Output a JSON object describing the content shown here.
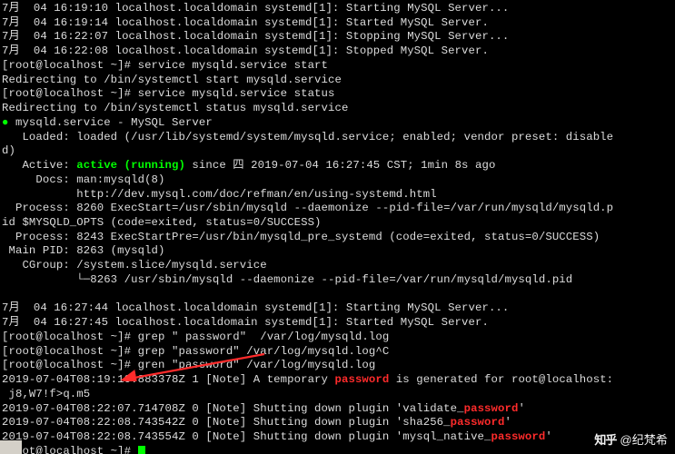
{
  "lines": [
    {
      "segments": [
        {
          "c": "",
          "t": "7月  04 16:19:10 localhost.localdomain systemd[1]: Starting MySQL Server..."
        }
      ]
    },
    {
      "segments": [
        {
          "c": "",
          "t": "7月  04 16:19:14 localhost.localdomain systemd[1]: Started MySQL Server."
        }
      ]
    },
    {
      "segments": [
        {
          "c": "",
          "t": "7月  04 16:22:07 localhost.localdomain systemd[1]: Stopping MySQL Server..."
        }
      ]
    },
    {
      "segments": [
        {
          "c": "",
          "t": "7月  04 16:22:08 localhost.localdomain systemd[1]: Stopped MySQL Server."
        }
      ]
    },
    {
      "segments": [
        {
          "c": "",
          "t": "[root@localhost ~]# service mysqld.service start"
        }
      ]
    },
    {
      "segments": [
        {
          "c": "",
          "t": "Redirecting to /bin/systemctl start mysqld.service"
        }
      ]
    },
    {
      "segments": [
        {
          "c": "",
          "t": "[root@localhost ~]# service mysqld.service status"
        }
      ]
    },
    {
      "segments": [
        {
          "c": "",
          "t": "Redirecting to /bin/systemctl status mysqld.service"
        }
      ]
    },
    {
      "segments": [
        {
          "c": "green",
          "t": "●"
        },
        {
          "c": "",
          "t": " mysqld.service - MySQL Server"
        }
      ]
    },
    {
      "segments": [
        {
          "c": "",
          "t": "   Loaded: loaded (/usr/lib/systemd/system/mysqld.service; enabled; vendor preset: disable"
        }
      ]
    },
    {
      "segments": [
        {
          "c": "",
          "t": "d)"
        }
      ]
    },
    {
      "segments": [
        {
          "c": "",
          "t": "   Active: "
        },
        {
          "c": "green bold",
          "t": "active (running)"
        },
        {
          "c": "",
          "t": " since 四 2019-07-04 16:27:45 CST; 1min 8s ago"
        }
      ]
    },
    {
      "segments": [
        {
          "c": "",
          "t": "     Docs: man:mysqld(8)"
        }
      ]
    },
    {
      "segments": [
        {
          "c": "",
          "t": "           http://dev.mysql.com/doc/refman/en/using-systemd.html"
        }
      ]
    },
    {
      "segments": [
        {
          "c": "",
          "t": "  Process: 8260 ExecStart=/usr/sbin/mysqld --daemonize --pid-file=/var/run/mysqld/mysqld.p"
        }
      ]
    },
    {
      "segments": [
        {
          "c": "",
          "t": "id $MYSQLD_OPTS (code=exited, status=0/SUCCESS)"
        }
      ]
    },
    {
      "segments": [
        {
          "c": "",
          "t": "  Process: 8243 ExecStartPre=/usr/bin/mysqld_pre_systemd (code=exited, status=0/SUCCESS)"
        }
      ]
    },
    {
      "segments": [
        {
          "c": "",
          "t": " Main PID: 8263 (mysqld)"
        }
      ]
    },
    {
      "segments": [
        {
          "c": "",
          "t": "   CGroup: /system.slice/mysqld.service"
        }
      ]
    },
    {
      "segments": [
        {
          "c": "",
          "t": "           └─8263 /usr/sbin/mysqld --daemonize --pid-file=/var/run/mysqld/mysqld.pid"
        }
      ]
    },
    {
      "segments": [
        {
          "c": "",
          "t": " "
        }
      ]
    },
    {
      "segments": [
        {
          "c": "",
          "t": "7月  04 16:27:44 localhost.localdomain systemd[1]: Starting MySQL Server..."
        }
      ]
    },
    {
      "segments": [
        {
          "c": "",
          "t": "7月  04 16:27:45 localhost.localdomain systemd[1]: Started MySQL Server."
        }
      ]
    },
    {
      "segments": [
        {
          "c": "",
          "t": "[root@localhost ~]# grep \" password\"  /var/log/mysqld.log"
        }
      ]
    },
    {
      "segments": [
        {
          "c": "",
          "t": "[root@localhost ~]# grep \"password\" /var/log/mysqld.log^C"
        }
      ]
    },
    {
      "segments": [
        {
          "c": "",
          "t": "[root@localhost ~]# gren \"password\" /var/log/mysqld.log"
        }
      ]
    },
    {
      "segments": [
        {
          "c": "",
          "t": "2019-07-04T08:19:10.883378Z 1 [Note] A temporary "
        },
        {
          "c": "red",
          "t": "password"
        },
        {
          "c": "",
          "t": " is generated for root@localhost:"
        }
      ]
    },
    {
      "segments": [
        {
          "c": "",
          "t": " j8,W7!f>q.m5"
        }
      ]
    },
    {
      "segments": [
        {
          "c": "",
          "t": "2019-07-04T08:22:07.714708Z 0 [Note] Shutting down plugin 'validate_"
        },
        {
          "c": "red",
          "t": "password"
        },
        {
          "c": "",
          "t": "'"
        }
      ]
    },
    {
      "segments": [
        {
          "c": "",
          "t": "2019-07-04T08:22:08.743542Z 0 [Note] Shutting down plugin 'sha256_"
        },
        {
          "c": "red",
          "t": "password"
        },
        {
          "c": "",
          "t": "'"
        }
      ]
    },
    {
      "segments": [
        {
          "c": "",
          "t": "2019-07-04T08:22:08.743554Z 0 [Note] Shutting down plugin 'mysql_native_"
        },
        {
          "c": "red",
          "t": "password"
        },
        {
          "c": "",
          "t": "'"
        }
      ]
    },
    {
      "segments": [
        {
          "c": "",
          "t": "[root@localhost ~]# "
        },
        {
          "c": "cursor",
          "t": ""
        }
      ]
    }
  ],
  "watermark": {
    "logo": "知乎",
    "at": "@纪梵希"
  },
  "annotation": {
    "type": "arrow",
    "color": "#ff2b2b"
  }
}
